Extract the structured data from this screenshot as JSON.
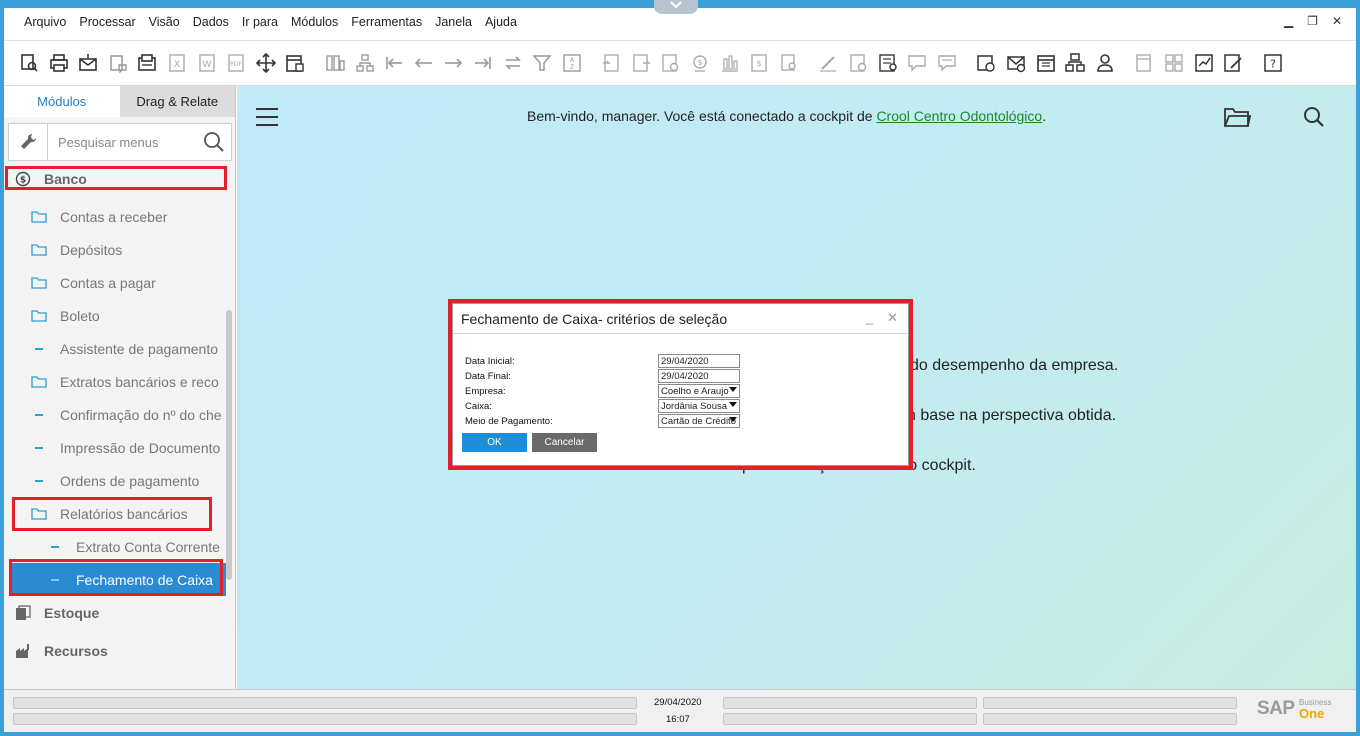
{
  "menubar": {
    "items": [
      "Arquivo",
      "Processar",
      "Visão",
      "Dados",
      "Ir para",
      "Módulos",
      "Ferramentas",
      "Janela",
      "Ajuda"
    ]
  },
  "sidebar": {
    "tabs": [
      "Módulos",
      "Drag & Relate"
    ],
    "search_placeholder": "Pesquisar menus",
    "items": [
      {
        "label": "Banco",
        "kind": "category",
        "icon": "dollar-circle-icon"
      },
      {
        "label": "Contas a receber",
        "kind": "folder",
        "icon": "folder-icon"
      },
      {
        "label": "Depósitos",
        "kind": "folder",
        "icon": "folder-icon"
      },
      {
        "label": "Contas a pagar",
        "kind": "folder",
        "icon": "folder-icon"
      },
      {
        "label": "Boleto",
        "kind": "folder",
        "icon": "folder-icon"
      },
      {
        "label": "Assistente de pagamento",
        "kind": "item",
        "icon": "dash-icon"
      },
      {
        "label": "Extratos bancários e reco",
        "kind": "folder",
        "icon": "folder-icon"
      },
      {
        "label": "Confirmação do nº do che",
        "kind": "item",
        "icon": "dash-icon"
      },
      {
        "label": "Impressão de Documento",
        "kind": "item",
        "icon": "dash-icon"
      },
      {
        "label": "Ordens de pagamento",
        "kind": "item",
        "icon": "dash-icon"
      },
      {
        "label": "Relatórios bancários",
        "kind": "folder",
        "icon": "folder-icon"
      },
      {
        "label": "Extrato Conta Corrente",
        "kind": "subitem",
        "icon": "dash-icon"
      },
      {
        "label": "Fechamento de Caixa",
        "kind": "selected",
        "icon": "dash-icon"
      },
      {
        "label": "Estoque",
        "kind": "category",
        "icon": "inventory-icon"
      },
      {
        "label": "Recursos",
        "kind": "category",
        "icon": "factory-icon"
      }
    ]
  },
  "main": {
    "welcome_prefix": "Bem-vindo, manager. Você está conectado a cockpit de ",
    "company_link": "Crool Centro Odontológico",
    "welcome_suffix": ".",
    "bg_line1": "do desempenho da empresa.",
    "bg_line2": "n base na perspectiva obtida.",
    "bg_line3": "para começar a utilizar o cockpit."
  },
  "dialog": {
    "title": "Fechamento de Caixa- critérios de seleção",
    "fields": [
      {
        "label": "Data Inicial:",
        "value": "29/04/2020",
        "dropdown": false
      },
      {
        "label": "Data Final:",
        "value": "29/04/2020",
        "dropdown": false
      },
      {
        "label": "Empresa:",
        "value": "Coelho e Araujo",
        "dropdown": true
      },
      {
        "label": "Caixa:",
        "value": "Jordânia Sousa",
        "dropdown": true
      },
      {
        "label": "Meio de Pagamento:",
        "value": "Cartão de Crédito",
        "dropdown": true
      }
    ],
    "ok_label": "OK",
    "cancel_label": "Cancelar"
  },
  "statusbar": {
    "date": "29/04/2020",
    "time": "16:07",
    "logo_main": "SAP",
    "logo_sub1": "Business",
    "logo_sub2": "One"
  },
  "colors": {
    "accent": "#2a8ad2",
    "highlight_red": "#e0202a",
    "link_green": "#1a8a2c"
  }
}
